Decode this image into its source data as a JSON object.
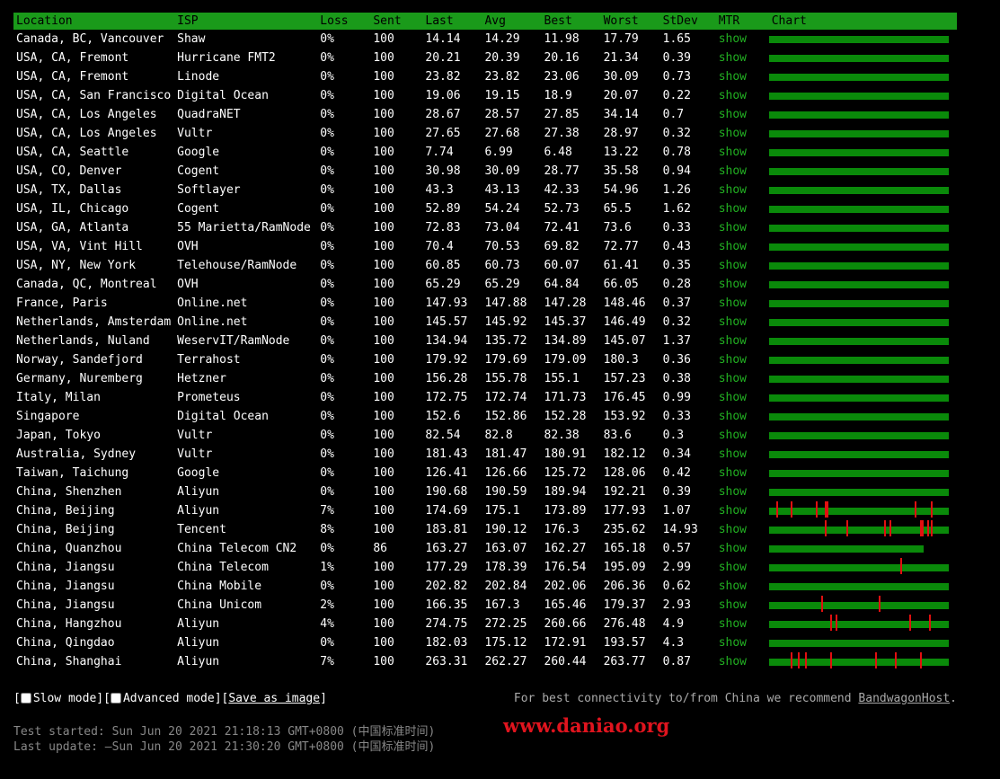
{
  "header": {
    "columns": [
      "Location",
      "ISP",
      "Loss",
      "Sent",
      "Last",
      "Avg",
      "Best",
      "Worst",
      "StDev",
      "MTR",
      "Chart"
    ]
  },
  "rows": [
    {
      "location": "Canada, BC, Vancouver",
      "isp": "Shaw",
      "loss": "0%",
      "sent": "100",
      "last": "14.14",
      "avg": "14.29",
      "best": "11.98",
      "worst": "17.79",
      "stdev": "1.65",
      "mtr": "show",
      "chart": {
        "fill": 1.0,
        "spikes": []
      }
    },
    {
      "location": "USA, CA, Fremont",
      "isp": "Hurricane FMT2",
      "loss": "0%",
      "sent": "100",
      "last": "20.21",
      "avg": "20.39",
      "best": "20.16",
      "worst": "21.34",
      "stdev": "0.39",
      "mtr": "show",
      "chart": {
        "fill": 1.0,
        "spikes": []
      }
    },
    {
      "location": "USA, CA, Fremont",
      "isp": "Linode",
      "loss": "0%",
      "sent": "100",
      "last": "23.82",
      "avg": "23.82",
      "best": "23.06",
      "worst": "30.09",
      "stdev": "0.73",
      "mtr": "show",
      "chart": {
        "fill": 1.0,
        "spikes": []
      }
    },
    {
      "location": "USA, CA, San Francisco",
      "isp": "Digital Ocean",
      "loss": "0%",
      "sent": "100",
      "last": "19.06",
      "avg": "19.15",
      "best": "18.9",
      "worst": "20.07",
      "stdev": "0.22",
      "mtr": "show",
      "chart": {
        "fill": 1.0,
        "spikes": []
      }
    },
    {
      "location": "USA, CA, Los Angeles",
      "isp": "QuadraNET",
      "loss": "0%",
      "sent": "100",
      "last": "28.67",
      "avg": "28.57",
      "best": "27.85",
      "worst": "34.14",
      "stdev": "0.7",
      "mtr": "show",
      "chart": {
        "fill": 1.0,
        "spikes": []
      }
    },
    {
      "location": "USA, CA, Los Angeles",
      "isp": "Vultr",
      "loss": "0%",
      "sent": "100",
      "last": "27.65",
      "avg": "27.68",
      "best": "27.38",
      "worst": "28.97",
      "stdev": "0.32",
      "mtr": "show",
      "chart": {
        "fill": 1.0,
        "spikes": []
      }
    },
    {
      "location": "USA, CA, Seattle",
      "isp": "Google",
      "loss": "0%",
      "sent": "100",
      "last": "7.74",
      "avg": "6.99",
      "best": "6.48",
      "worst": "13.22",
      "stdev": "0.78",
      "mtr": "show",
      "chart": {
        "fill": 1.0,
        "spikes": []
      }
    },
    {
      "location": "USA, CO, Denver",
      "isp": "Cogent",
      "loss": "0%",
      "sent": "100",
      "last": "30.98",
      "avg": "30.09",
      "best": "28.77",
      "worst": "35.58",
      "stdev": "0.94",
      "mtr": "show",
      "chart": {
        "fill": 1.0,
        "spikes": []
      }
    },
    {
      "location": "USA, TX, Dallas",
      "isp": "Softlayer",
      "loss": "0%",
      "sent": "100",
      "last": "43.3",
      "avg": "43.13",
      "best": "42.33",
      "worst": "54.96",
      "stdev": "1.26",
      "mtr": "show",
      "chart": {
        "fill": 1.0,
        "spikes": []
      }
    },
    {
      "location": "USA, IL, Chicago",
      "isp": "Cogent",
      "loss": "0%",
      "sent": "100",
      "last": "52.89",
      "avg": "54.24",
      "best": "52.73",
      "worst": "65.5",
      "stdev": "1.62",
      "mtr": "show",
      "chart": {
        "fill": 1.0,
        "spikes": []
      }
    },
    {
      "location": "USA, GA, Atlanta",
      "isp": "55 Marietta/RamNode",
      "loss": "0%",
      "sent": "100",
      "last": "72.83",
      "avg": "73.04",
      "best": "72.41",
      "worst": "73.6",
      "stdev": "0.33",
      "mtr": "show",
      "chart": {
        "fill": 1.0,
        "spikes": []
      }
    },
    {
      "location": "USA, VA, Vint Hill",
      "isp": "OVH",
      "loss": "0%",
      "sent": "100",
      "last": "70.4",
      "avg": "70.53",
      "best": "69.82",
      "worst": "72.77",
      "stdev": "0.43",
      "mtr": "show",
      "chart": {
        "fill": 1.0,
        "spikes": []
      }
    },
    {
      "location": "USA, NY, New York",
      "isp": "Telehouse/RamNode",
      "loss": "0%",
      "sent": "100",
      "last": "60.85",
      "avg": "60.73",
      "best": "60.07",
      "worst": "61.41",
      "stdev": "0.35",
      "mtr": "show",
      "chart": {
        "fill": 1.0,
        "spikes": []
      }
    },
    {
      "location": "Canada, QC, Montreal",
      "isp": "OVH",
      "loss": "0%",
      "sent": "100",
      "last": "65.29",
      "avg": "65.29",
      "best": "64.84",
      "worst": "66.05",
      "stdev": "0.28",
      "mtr": "show",
      "chart": {
        "fill": 1.0,
        "spikes": []
      }
    },
    {
      "location": "France, Paris",
      "isp": "Online.net",
      "loss": "0%",
      "sent": "100",
      "last": "147.93",
      "avg": "147.88",
      "best": "147.28",
      "worst": "148.46",
      "stdev": "0.37",
      "mtr": "show",
      "chart": {
        "fill": 1.0,
        "spikes": []
      }
    },
    {
      "location": "Netherlands, Amsterdam",
      "isp": "Online.net",
      "loss": "0%",
      "sent": "100",
      "last": "145.57",
      "avg": "145.92",
      "best": "145.37",
      "worst": "146.49",
      "stdev": "0.32",
      "mtr": "show",
      "chart": {
        "fill": 1.0,
        "spikes": []
      }
    },
    {
      "location": "Netherlands, Nuland",
      "isp": "WeservIT/RamNode",
      "loss": "0%",
      "sent": "100",
      "last": "134.94",
      "avg": "135.72",
      "best": "134.89",
      "worst": "145.07",
      "stdev": "1.37",
      "mtr": "show",
      "chart": {
        "fill": 1.0,
        "spikes": []
      }
    },
    {
      "location": "Norway, Sandefjord",
      "isp": "Terrahost",
      "loss": "0%",
      "sent": "100",
      "last": "179.92",
      "avg": "179.69",
      "best": "179.09",
      "worst": "180.3",
      "stdev": "0.36",
      "mtr": "show",
      "chart": {
        "fill": 1.0,
        "spikes": []
      }
    },
    {
      "location": "Germany, Nuremberg",
      "isp": "Hetzner",
      "loss": "0%",
      "sent": "100",
      "last": "156.28",
      "avg": "155.78",
      "best": "155.1",
      "worst": "157.23",
      "stdev": "0.38",
      "mtr": "show",
      "chart": {
        "fill": 1.0,
        "spikes": []
      }
    },
    {
      "location": "Italy, Milan",
      "isp": "Prometeus",
      "loss": "0%",
      "sent": "100",
      "last": "172.75",
      "avg": "172.74",
      "best": "171.73",
      "worst": "176.45",
      "stdev": "0.99",
      "mtr": "show",
      "chart": {
        "fill": 1.0,
        "spikes": []
      }
    },
    {
      "location": "Singapore",
      "isp": "Digital Ocean",
      "loss": "0%",
      "sent": "100",
      "last": "152.6",
      "avg": "152.86",
      "best": "152.28",
      "worst": "153.92",
      "stdev": "0.33",
      "mtr": "show",
      "chart": {
        "fill": 1.0,
        "spikes": []
      }
    },
    {
      "location": "Japan, Tokyo",
      "isp": "Vultr",
      "loss": "0%",
      "sent": "100",
      "last": "82.54",
      "avg": "82.8",
      "best": "82.38",
      "worst": "83.6",
      "stdev": "0.3",
      "mtr": "show",
      "chart": {
        "fill": 1.0,
        "spikes": []
      }
    },
    {
      "location": "Australia, Sydney",
      "isp": "Vultr",
      "loss": "0%",
      "sent": "100",
      "last": "181.43",
      "avg": "181.47",
      "best": "180.91",
      "worst": "182.12",
      "stdev": "0.34",
      "mtr": "show",
      "chart": {
        "fill": 1.0,
        "spikes": []
      }
    },
    {
      "location": "Taiwan, Taichung",
      "isp": "Google",
      "loss": "0%",
      "sent": "100",
      "last": "126.41",
      "avg": "126.66",
      "best": "125.72",
      "worst": "128.06",
      "stdev": "0.42",
      "mtr": "show",
      "chart": {
        "fill": 1.0,
        "spikes": []
      }
    },
    {
      "location": "China, Shenzhen",
      "isp": "Aliyun",
      "loss": "0%",
      "sent": "100",
      "last": "190.68",
      "avg": "190.59",
      "best": "189.94",
      "worst": "192.21",
      "stdev": "0.39",
      "mtr": "show",
      "chart": {
        "fill": 1.0,
        "spikes": []
      }
    },
    {
      "location": "China, Beijing",
      "isp": "Aliyun",
      "loss": "7%",
      "sent": "100",
      "last": "174.69",
      "avg": "175.1",
      "best": "173.89",
      "worst": "177.93",
      "stdev": "1.07",
      "mtr": "show",
      "chart": {
        "fill": 1.0,
        "spikes": [
          4,
          12,
          26,
          31,
          32,
          81,
          90
        ]
      }
    },
    {
      "location": "China, Beijing",
      "isp": "Tencent",
      "loss": "8%",
      "sent": "100",
      "last": "183.81",
      "avg": "190.12",
      "best": "176.3",
      "worst": "235.62",
      "stdev": "14.93",
      "mtr": "show",
      "chart": {
        "fill": 1.0,
        "spikes": [
          31,
          43,
          64,
          67,
          84,
          85,
          88,
          90
        ]
      }
    },
    {
      "location": "China, Quanzhou",
      "isp": "China Telecom CN2",
      "loss": "0%",
      "sent": "86",
      "last": "163.27",
      "avg": "163.07",
      "best": "162.27",
      "worst": "165.18",
      "stdev": "0.57",
      "mtr": "show",
      "chart": {
        "fill": 0.86,
        "spikes": []
      }
    },
    {
      "location": "China, Jiangsu",
      "isp": "China Telecom",
      "loss": "1%",
      "sent": "100",
      "last": "177.29",
      "avg": "178.39",
      "best": "176.54",
      "worst": "195.09",
      "stdev": "2.99",
      "mtr": "show",
      "chart": {
        "fill": 1.0,
        "spikes": [
          73
        ]
      }
    },
    {
      "location": "China, Jiangsu",
      "isp": "China Mobile",
      "loss": "0%",
      "sent": "100",
      "last": "202.82",
      "avg": "202.84",
      "best": "202.06",
      "worst": "206.36",
      "stdev": "0.62",
      "mtr": "show",
      "chart": {
        "fill": 1.0,
        "spikes": []
      }
    },
    {
      "location": "China, Jiangsu",
      "isp": "China Unicom",
      "loss": "2%",
      "sent": "100",
      "last": "166.35",
      "avg": "167.3",
      "best": "165.46",
      "worst": "179.37",
      "stdev": "2.93",
      "mtr": "show",
      "chart": {
        "fill": 1.0,
        "spikes": [
          29,
          61
        ]
      }
    },
    {
      "location": "China, Hangzhou",
      "isp": "Aliyun",
      "loss": "4%",
      "sent": "100",
      "last": "274.75",
      "avg": "272.25",
      "best": "260.66",
      "worst": "276.48",
      "stdev": "4.9",
      "mtr": "show",
      "chart": {
        "fill": 1.0,
        "spikes": [
          34,
          37,
          78,
          89
        ]
      }
    },
    {
      "location": "China, Qingdao",
      "isp": "Aliyun",
      "loss": "0%",
      "sent": "100",
      "last": "182.03",
      "avg": "175.12",
      "best": "172.91",
      "worst": "193.57",
      "stdev": "4.3",
      "mtr": "show",
      "chart": {
        "fill": 1.0,
        "spikes": []
      }
    },
    {
      "location": "China, Shanghai",
      "isp": "Aliyun",
      "loss": "7%",
      "sent": "100",
      "last": "263.31",
      "avg": "262.27",
      "best": "260.44",
      "worst": "263.77",
      "stdev": "0.87",
      "mtr": "show",
      "chart": {
        "fill": 1.0,
        "spikes": [
          12,
          16,
          20,
          34,
          59,
          70,
          84
        ]
      }
    }
  ],
  "controls": {
    "open_bracket": "[",
    "slow_mode": "Slow mode",
    "separator": "][",
    "advanced_mode": "Advanced mode",
    "close_bracket": "]",
    "save_link_open": "[",
    "save_as_image": "Save as image",
    "save_link_close": "]"
  },
  "recommend": {
    "text": "For best connectivity to/from China we recommend ",
    "link": "BandwagonHost",
    "end": "."
  },
  "timestamps": {
    "started": "Test started: Sun Jun 20 2021 21:18:13 GMT+0800 (中国标准时间)",
    "updated": "Last update: —Sun Jun 20 2021 21:30:20 GMT+0800 (中国标准时间)"
  },
  "watermark": "www.daniao.org",
  "colors": {
    "header_bg": "#1a9a1a",
    "bar": "#0a8a0a",
    "spike": "#e01010",
    "mtr_link": "#22b022"
  }
}
